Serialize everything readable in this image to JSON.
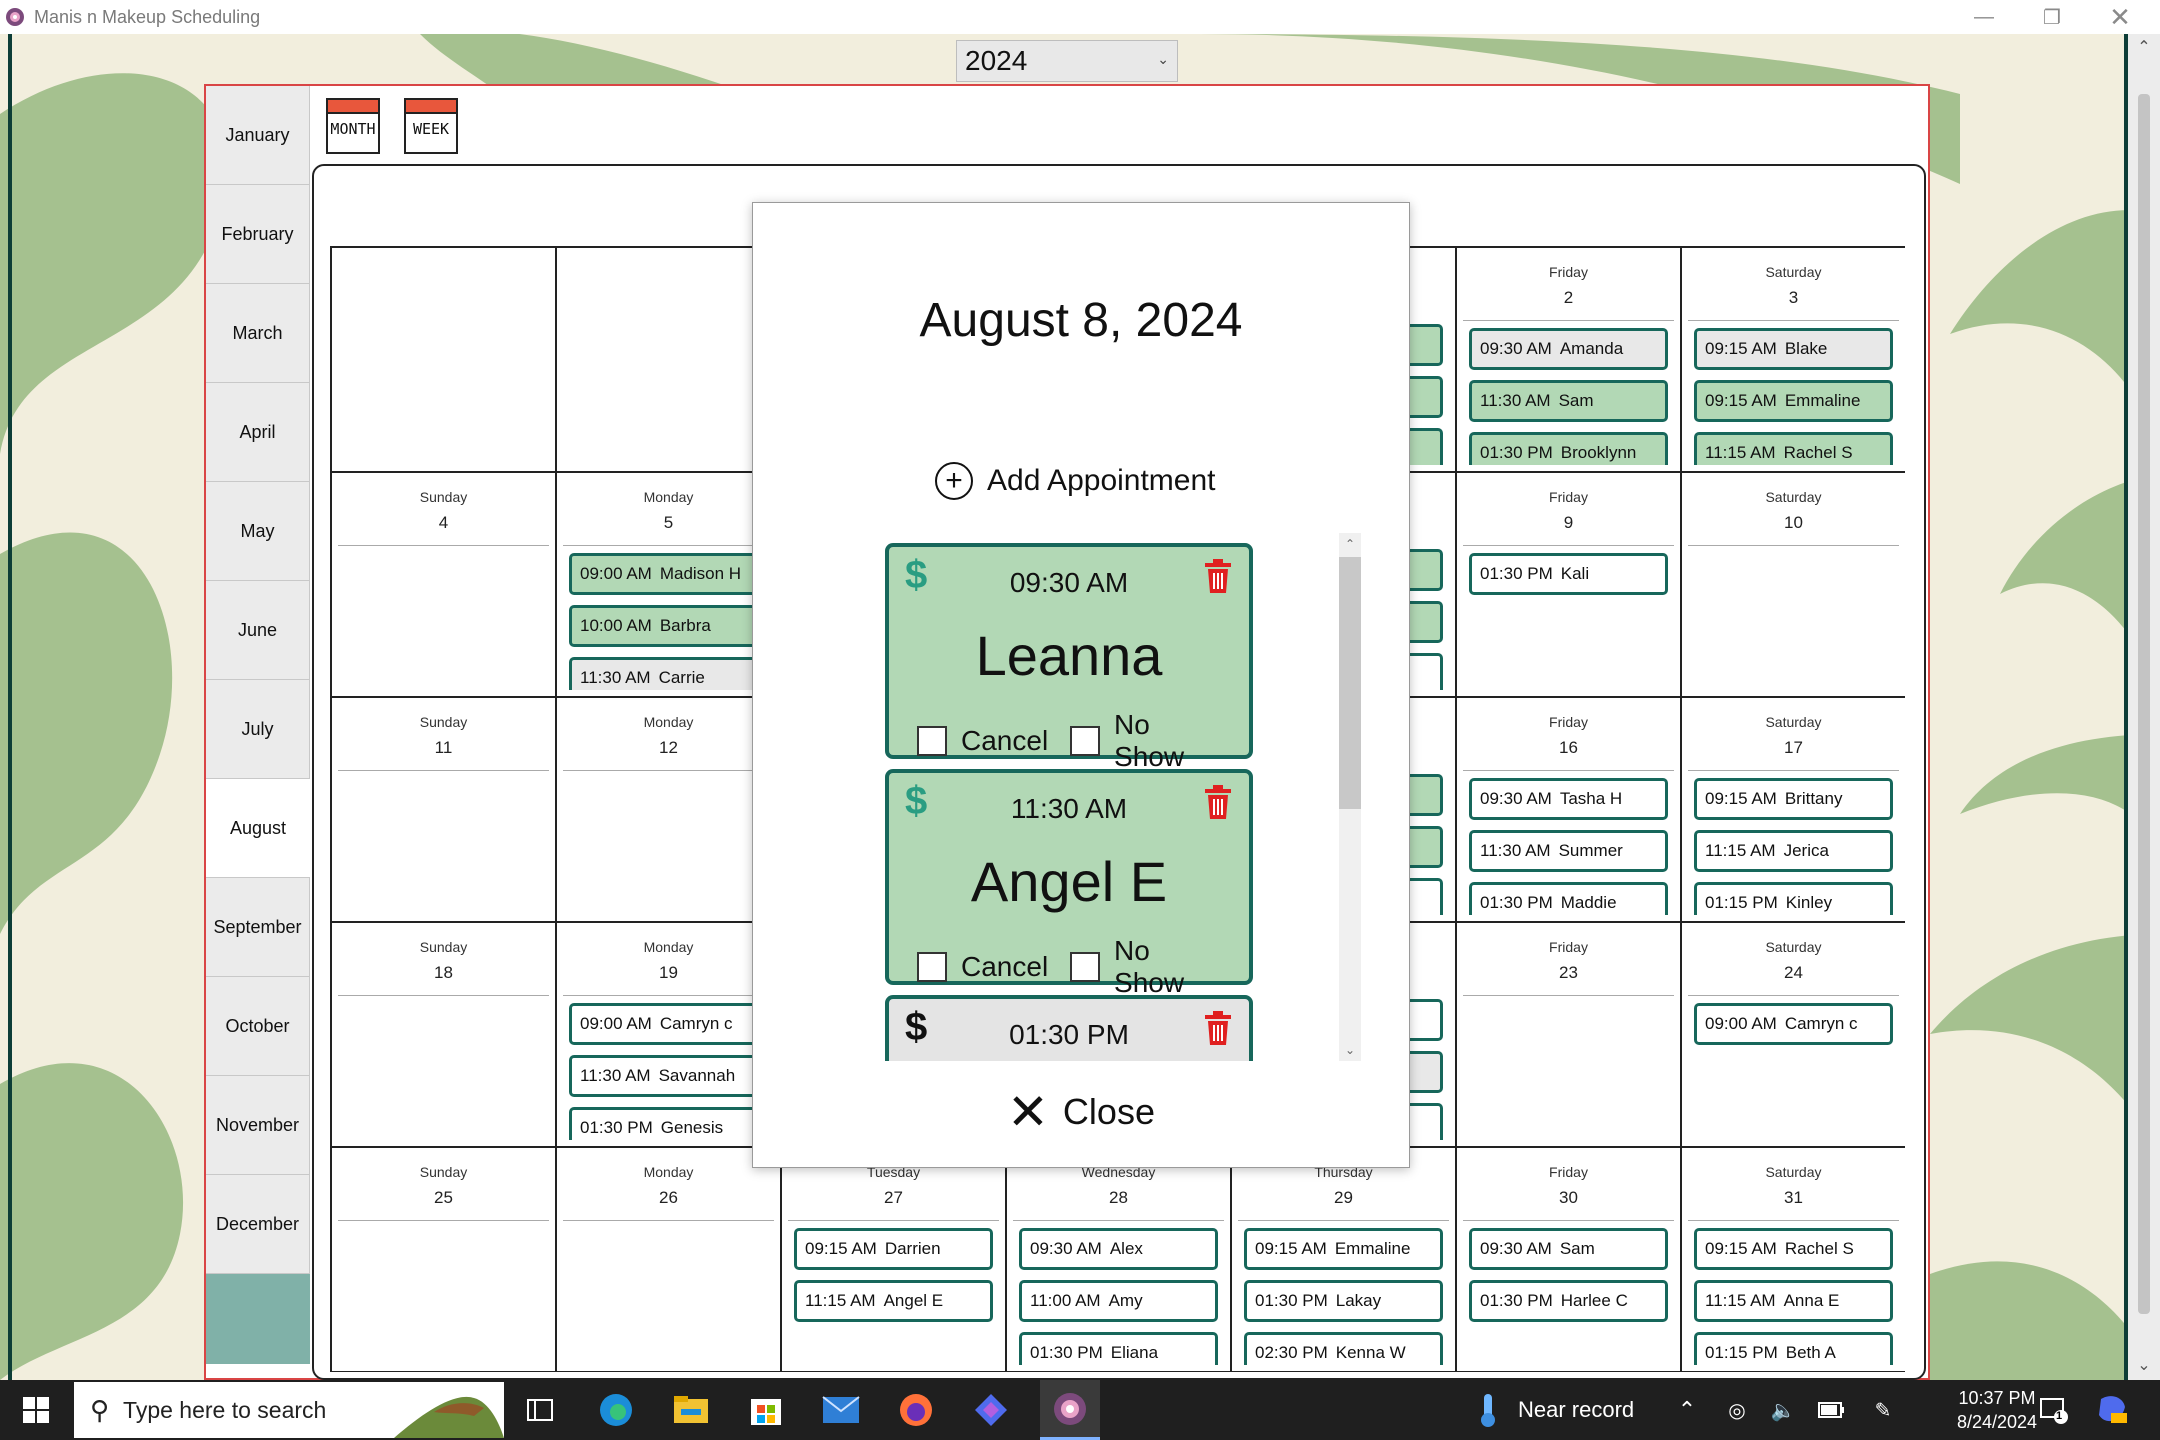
{
  "window": {
    "title": "Manis n Makeup Scheduling",
    "controls": [
      "minimize",
      "restore",
      "close"
    ]
  },
  "toolbar": {
    "year": "2024",
    "month_view_label": "MONTH",
    "week_view_label": "WEEK"
  },
  "months": [
    "January",
    "February",
    "March",
    "April",
    "May",
    "June",
    "July",
    "August",
    "September",
    "October",
    "November",
    "December"
  ],
  "selected_month": "August",
  "calendar": {
    "weeks": [
      [
        {
          "dow": "",
          "day": "",
          "appts": []
        },
        {
          "dow": "",
          "day": "",
          "appts": []
        },
        {
          "dow": "",
          "day": "",
          "appts": []
        },
        {
          "dow": "",
          "day": "",
          "appts": []
        },
        {
          "dow": "",
          "day": "",
          "appts": [
            {
              "time": "",
              "name": "",
              "style": "paid"
            },
            {
              "time": "",
              "name": "",
              "style": "paid"
            },
            {
              "time": "",
              "name": "",
              "style": "paid"
            }
          ]
        },
        {
          "dow": "Friday",
          "day": "2",
          "appts": [
            {
              "time": "09:30 AM",
              "name": "Amanda",
              "style": "grey"
            },
            {
              "time": "11:30 AM",
              "name": "Sam",
              "style": "paid"
            },
            {
              "time": "01:30 PM",
              "name": "Brooklynn",
              "style": "paid"
            }
          ]
        },
        {
          "dow": "Saturday",
          "day": "3",
          "appts": [
            {
              "time": "09:15 AM",
              "name": "Blake",
              "style": "grey"
            },
            {
              "time": "09:15 AM",
              "name": "Emmaline",
              "style": "paid"
            },
            {
              "time": "11:15 AM",
              "name": "Rachel S",
              "style": "paid"
            }
          ]
        }
      ],
      [
        {
          "dow": "Sunday",
          "day": "4",
          "appts": []
        },
        {
          "dow": "Monday",
          "day": "5",
          "appts": [
            {
              "time": "09:00 AM",
              "name": "Madison H",
              "style": "paid"
            },
            {
              "time": "10:00 AM",
              "name": "Barbra",
              "style": "paid"
            },
            {
              "time": "11:30 AM",
              "name": "Carrie",
              "style": "grey"
            }
          ]
        },
        {
          "dow": "",
          "day": "",
          "appts": []
        },
        {
          "dow": "",
          "day": "",
          "appts": []
        },
        {
          "dow": "",
          "day": "",
          "appts": [
            {
              "time": "",
              "name": "",
              "style": "paid"
            },
            {
              "time": "",
              "name": "",
              "style": "paid"
            },
            {
              "time": "",
              "name": "",
              "style": ""
            }
          ]
        },
        {
          "dow": "Friday",
          "day": "9",
          "appts": [
            {
              "time": "01:30 PM",
              "name": "Kali",
              "style": ""
            }
          ]
        },
        {
          "dow": "Saturday",
          "day": "10",
          "appts": []
        }
      ],
      [
        {
          "dow": "Sunday",
          "day": "11",
          "appts": []
        },
        {
          "dow": "Monday",
          "day": "12",
          "appts": []
        },
        {
          "dow": "",
          "day": "",
          "appts": []
        },
        {
          "dow": "",
          "day": "",
          "appts": []
        },
        {
          "dow": "",
          "day": "",
          "appts": [
            {
              "time": "",
              "name": "",
              "style": "paid"
            },
            {
              "time": "",
              "name": "",
              "style": "paid"
            },
            {
              "time": "",
              "name": "",
              "style": ""
            }
          ]
        },
        {
          "dow": "Friday",
          "day": "16",
          "appts": [
            {
              "time": "09:30 AM",
              "name": "Tasha H",
              "style": ""
            },
            {
              "time": "11:30 AM",
              "name": "Summer",
              "style": ""
            },
            {
              "time": "01:30 PM",
              "name": "Maddie",
              "style": ""
            }
          ]
        },
        {
          "dow": "Saturday",
          "day": "17",
          "appts": [
            {
              "time": "09:15 AM",
              "name": "Brittany",
              "style": ""
            },
            {
              "time": "11:15 AM",
              "name": "Jerica",
              "style": ""
            },
            {
              "time": "01:15 PM",
              "name": "Kinley",
              "style": ""
            }
          ]
        }
      ],
      [
        {
          "dow": "Sunday",
          "day": "18",
          "appts": []
        },
        {
          "dow": "Monday",
          "day": "19",
          "appts": [
            {
              "time": "09:00 AM",
              "name": "Camryn c",
              "style": ""
            },
            {
              "time": "11:30 AM",
              "name": "Savannah",
              "style": ""
            },
            {
              "time": "01:30 PM",
              "name": "Genesis",
              "style": ""
            }
          ]
        },
        {
          "dow": "",
          "day": "",
          "appts": []
        },
        {
          "dow": "",
          "day": "",
          "appts": []
        },
        {
          "dow": "",
          "day": "",
          "appts": [
            {
              "time": "",
              "name": "",
              "style": ""
            },
            {
              "time": "",
              "name": "",
              "style": "grey"
            },
            {
              "time": "",
              "name": "",
              "style": ""
            }
          ]
        },
        {
          "dow": "Friday",
          "day": "23",
          "appts": []
        },
        {
          "dow": "Saturday",
          "day": "24",
          "appts": [
            {
              "time": "09:00 AM",
              "name": "Camryn c",
              "style": ""
            }
          ]
        }
      ],
      [
        {
          "dow": "Sunday",
          "day": "25",
          "appts": []
        },
        {
          "dow": "Monday",
          "day": "26",
          "appts": []
        },
        {
          "dow": "Tuesday",
          "day": "27",
          "appts": [
            {
              "time": "09:15 AM",
              "name": "Darrien",
              "style": ""
            },
            {
              "time": "11:15 AM",
              "name": "Angel E",
              "style": ""
            }
          ]
        },
        {
          "dow": "Wednesday",
          "day": "28",
          "appts": [
            {
              "time": "09:30 AM",
              "name": "Alex",
              "style": ""
            },
            {
              "time": "11:00 AM",
              "name": "Amy",
              "style": ""
            },
            {
              "time": "01:30 PM",
              "name": "Eliana",
              "style": ""
            }
          ]
        },
        {
          "dow": "Thursday",
          "day": "29",
          "appts": [
            {
              "time": "09:15 AM",
              "name": "Emmaline",
              "style": ""
            },
            {
              "time": "01:30 PM",
              "name": "Lakay",
              "style": ""
            },
            {
              "time": "02:30 PM",
              "name": "Kenna W",
              "style": ""
            }
          ]
        },
        {
          "dow": "Friday",
          "day": "30",
          "appts": [
            {
              "time": "09:30 AM",
              "name": "Sam",
              "style": ""
            },
            {
              "time": "01:30 PM",
              "name": "Harlee C",
              "style": ""
            }
          ]
        },
        {
          "dow": "Saturday",
          "day": "31",
          "appts": [
            {
              "time": "09:15 AM",
              "name": "Rachel S",
              "style": ""
            },
            {
              "time": "11:15 AM",
              "name": "Anna E",
              "style": ""
            },
            {
              "time": "01:15 PM",
              "name": "Beth A",
              "style": ""
            }
          ]
        }
      ]
    ]
  },
  "modal": {
    "date": "August 8, 2024",
    "add_label": "Add Appointment",
    "close_label": "Close",
    "cancel_label": "Cancel",
    "noshow_label": "No Show",
    "appointments": [
      {
        "time": "09:30 AM",
        "name": "Leanna",
        "style": "paid"
      },
      {
        "time": "11:30 AM",
        "name": "Angel E",
        "style": "paid"
      },
      {
        "time": "01:30 PM",
        "name": "",
        "style": "grey"
      }
    ]
  },
  "taskbar": {
    "search_placeholder": "Type here to search",
    "weather": "Near record",
    "time": "10:37 PM",
    "date": "8/24/2024",
    "notification_count": "1",
    "apps": [
      "task-view-icon",
      "edge-icon",
      "file-explorer-icon",
      "store-icon",
      "mail-icon",
      "firefox-icon",
      "copilot-icon",
      "scheduler-app-icon"
    ]
  },
  "colors": {
    "accent_border": "#17675b",
    "paid_fill": "#b2d8b5",
    "trash_red": "#e02020",
    "panel_border": "#d94545",
    "background_swirl": "#a5c18f"
  }
}
